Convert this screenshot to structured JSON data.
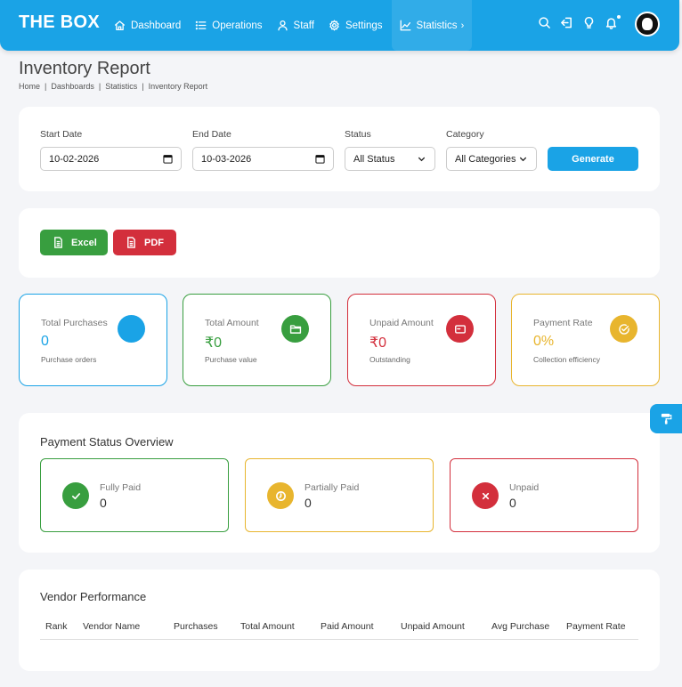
{
  "brand": "THE BOX",
  "nav": [
    {
      "label": "Dashboard",
      "icon": "home-icon"
    },
    {
      "label": "Operations",
      "icon": "list-icon"
    },
    {
      "label": "Staff",
      "icon": "user-icon"
    },
    {
      "label": "Settings",
      "icon": "gear-icon"
    },
    {
      "label": "Statistics",
      "icon": "chart-icon",
      "active": true
    }
  ],
  "page": {
    "title": "Inventory Report",
    "breadcrumb": [
      "Home",
      "Dashboards",
      "Statistics",
      "Inventory Report"
    ]
  },
  "filters": {
    "start_date_label": "Start Date",
    "start_date_value": "10-02-2026",
    "end_date_label": "End Date",
    "end_date_value": "10-03-2026",
    "status_label": "Status",
    "status_value": "All Status",
    "category_label": "Category",
    "category_value": "All Categories",
    "generate_label": "Generate"
  },
  "export": {
    "excel_label": "Excel",
    "pdf_label": "PDF"
  },
  "stats": [
    {
      "label": "Total Purchases",
      "value": "0",
      "sub": "Purchase orders",
      "color": "#1aa3e6",
      "icon": "circle-icon"
    },
    {
      "label": "Total Amount",
      "value": "₹0",
      "sub": "Purchase value",
      "color": "#389e3f",
      "icon": "folder-icon"
    },
    {
      "label": "Unpaid Amount",
      "value": "₹0",
      "sub": "Outstanding",
      "color": "#d32f3c",
      "icon": "card-icon"
    },
    {
      "label": "Payment Rate",
      "value": "0%",
      "sub": "Collection efficiency",
      "color": "#e8b52e",
      "icon": "check-circle-icon"
    }
  ],
  "payment_status": {
    "title": "Payment Status Overview",
    "items": [
      {
        "label": "Fully Paid",
        "count": "0",
        "color": "#389e3f",
        "icon": "check-icon"
      },
      {
        "label": "Partially Paid",
        "count": "0",
        "color": "#e8b52e",
        "icon": "clock-icon"
      },
      {
        "label": "Unpaid",
        "count": "0",
        "color": "#d32f3c",
        "icon": "x-icon"
      }
    ]
  },
  "vendor": {
    "title": "Vendor Performance",
    "columns": [
      "Rank",
      "Vendor Name",
      "Purchases",
      "Total Amount",
      "Paid Amount",
      "Unpaid Amount",
      "Avg Purchase",
      "Payment Rate"
    ]
  },
  "colors": {
    "primary": "#1aa3e6",
    "success": "#389e3f",
    "danger": "#d32f3c",
    "warning": "#e8b52e"
  }
}
